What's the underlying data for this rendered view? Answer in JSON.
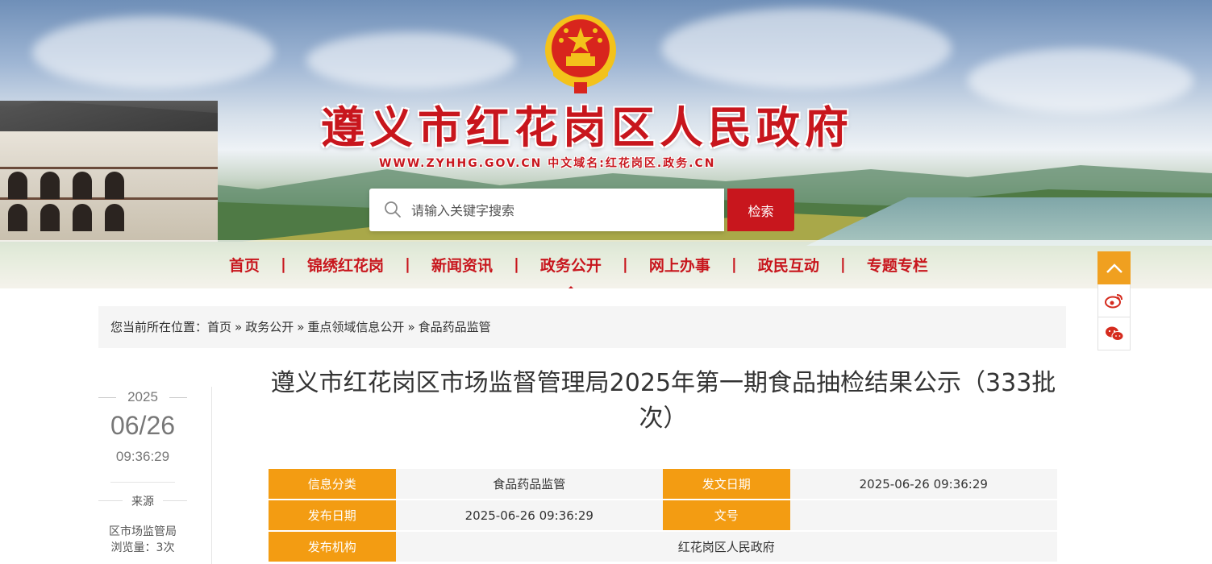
{
  "site": {
    "title": "遵义市红花岗区人民政府",
    "domain": "WWW.ZYHHG.GOV.CN  中文域名:红花岗区.政务.CN"
  },
  "search": {
    "placeholder": "请输入关键字搜索",
    "button": "检索"
  },
  "nav": {
    "items": [
      "首页",
      "锦绣红花岗",
      "新闻资讯",
      "政务公开",
      "网上办事",
      "政民互动",
      "专题专栏"
    ],
    "separator": "|",
    "active": "政务公开"
  },
  "float": {
    "top_icon": "chevron-up-icon",
    "weibo_icon": "weibo-icon",
    "wechat_icon": "wechat-icon"
  },
  "breadcrumb": {
    "prefix": "您当前所在位置：",
    "items": [
      "首页",
      "政务公开",
      "重点领域信息公开",
      "食品药品监管"
    ],
    "separator": "»"
  },
  "article": {
    "year": "2025",
    "month_day": "06/26",
    "time": "09:36:29",
    "source_label": "来源",
    "source": "区市场监管局",
    "views": "浏览量：3次",
    "title": "遵义市红花岗区市场监督管理局2025年第一期食品抽检结果公示（333批次）"
  },
  "info": {
    "category_label": "信息分类",
    "category": "食品药品监管",
    "issue_date_label": "发文日期",
    "issue_date": "2025-06-26 09:36:29",
    "publish_date_label": "发布日期",
    "publish_date": "2025-06-26 09:36:29",
    "doc_no_label": "文号",
    "doc_no": "",
    "org_label": "发布机构",
    "org": "红花岗区人民政府"
  },
  "colors": {
    "brand_red": "#c8161d",
    "accent_orange": "#f39c12"
  }
}
